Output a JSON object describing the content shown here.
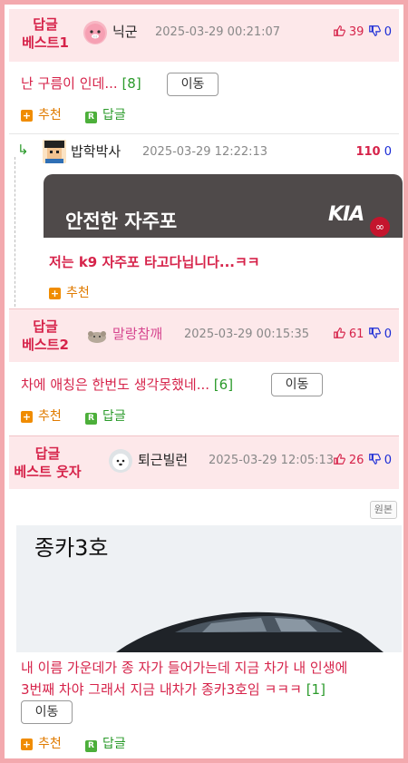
{
  "posts": [
    {
      "best_label": "답글\n베스트1",
      "best_label_line1": "답글",
      "best_label_line2": "베스트1",
      "nick": "닉군",
      "date": "2025-03-29 00:21:07",
      "up": "39",
      "down": "0",
      "text": "난 구름이 인데...",
      "count": "[8]",
      "move": "이동",
      "recommend": "추천",
      "reply": "답글"
    },
    {
      "best_label_line1": "답글",
      "best_label_line2": "베스트2",
      "nick": "말랑참깨",
      "date": "2025-03-29 00:15:35",
      "up": "61",
      "down": "0",
      "text": "차에 애칭은 한번도 생각못했네...",
      "count": "[6]",
      "move": "이동",
      "recommend": "추천",
      "reply": "답글"
    },
    {
      "best_label_line1": "답글",
      "best_label_line2": "베스트 웃자",
      "nick": "퇴근빌런",
      "date": "2025-03-29 12:05:13",
      "up": "26",
      "down": "0",
      "original": "원본",
      "image_title": "종카3호",
      "text_line1": "내 이름 가운데가 종 자가 들어가는데 지금 차가 내 인생에",
      "text_line2": "3번째 차야 그래서 지금 내차가 종카3호임 ㅋㅋㅋ",
      "count": "[1]",
      "move": "이동",
      "recommend": "추천",
      "reply": "답글"
    }
  ],
  "sub_reply": {
    "nick": "밥학박사",
    "date": "2025-03-29 12:22:13",
    "up": "110",
    "down": "0",
    "ad_text": "안전한 자주포",
    "ad_logo": "KIA",
    "text": "저는 k9 자주포 타고다닙니다...ㅋㅋ",
    "recommend": "추천"
  },
  "colors": {
    "accent": "#d6234a",
    "header_bg": "#fde8ea",
    "border": "#f3a9ae",
    "recommend": "#f08c00",
    "reply": "#4caf3a"
  }
}
